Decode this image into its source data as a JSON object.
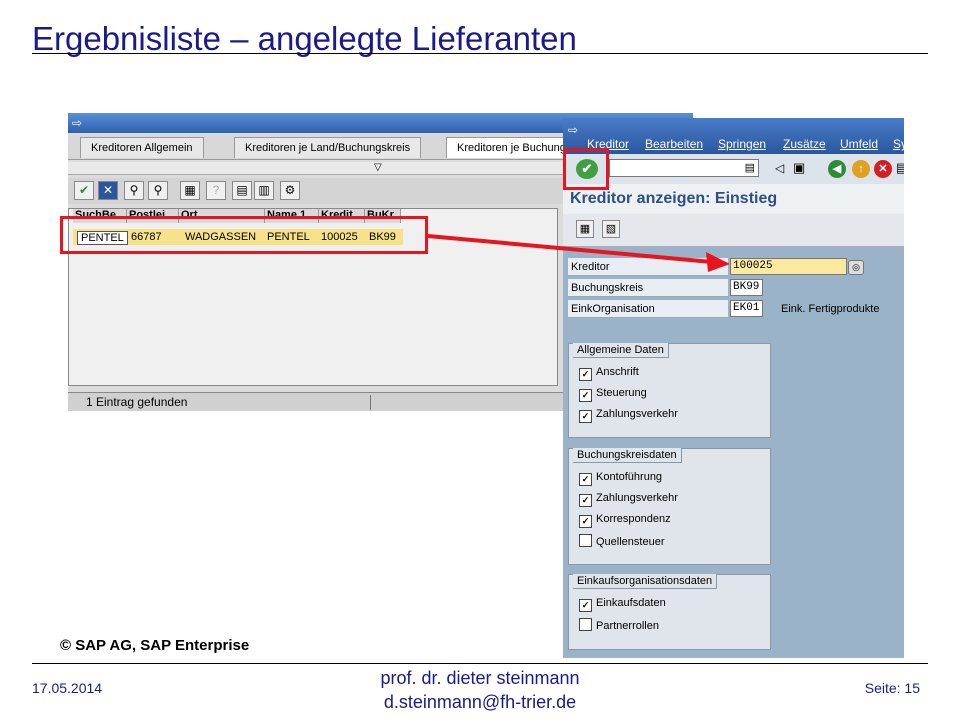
{
  "slide": {
    "title": "Ergebnisliste – angelegte Lieferanten",
    "copyright": "© SAP AG, SAP Enterprise",
    "footer_date": "17.05.2014",
    "footer_author": "prof. dr. dieter steinmann",
    "footer_email": "d.steinmann@fh-trier.de",
    "footer_page": "Seite: 15"
  },
  "list_window": {
    "tabs": [
      "Kreditoren Allgemein",
      "Kreditoren je Land/Buchungskreis",
      "Kreditoren je Buchung"
    ],
    "columns": [
      "SuchBe",
      "Postlei",
      "Ort",
      "Name 1",
      "Kredit",
      "BuKr"
    ],
    "rows": [
      {
        "suchbe": "PENTEL",
        "postleitzahl": "66787",
        "ort": "WADGASSEN",
        "name": "PENTEL",
        "kreditor": "100025",
        "bukr": "BK99"
      }
    ],
    "status": "1 Eintrag gefunden"
  },
  "detail_window": {
    "menu": [
      "Kreditor",
      "Bearbeiten",
      "Springen",
      "Zusätze",
      "Umfeld",
      "Sy"
    ],
    "screen_title": "Kreditor anzeigen: Einstieg",
    "fields": [
      {
        "label": "Kreditor",
        "value": "100025",
        "text": ""
      },
      {
        "label": "Buchungskreis",
        "value": "BK99",
        "text": ""
      },
      {
        "label": "EinkOrganisation",
        "value": "EK01",
        "text": "Eink. Fertigprodukte"
      }
    ],
    "groups": [
      {
        "title": "Allgemeine Daten",
        "items": [
          {
            "label": "Anschrift",
            "checked": true
          },
          {
            "label": "Steuerung",
            "checked": true
          },
          {
            "label": "Zahlungsverkehr",
            "checked": true
          }
        ]
      },
      {
        "title": "Buchungskreisdaten",
        "items": [
          {
            "label": "Kontoführung",
            "checked": true
          },
          {
            "label": "Zahlungsverkehr",
            "checked": true
          },
          {
            "label": "Korrespondenz",
            "checked": true
          },
          {
            "label": "Quellensteuer",
            "checked": false
          }
        ]
      },
      {
        "title": "Einkaufsorganisationsdaten",
        "items": [
          {
            "label": "Einkaufsdaten",
            "checked": true
          },
          {
            "label": "Partnerrollen",
            "checked": false
          }
        ]
      }
    ]
  },
  "colors": {
    "accent_red": "#e8141e",
    "highlight_row": "#f7e28a",
    "title_blue": "#1a1a8c"
  }
}
